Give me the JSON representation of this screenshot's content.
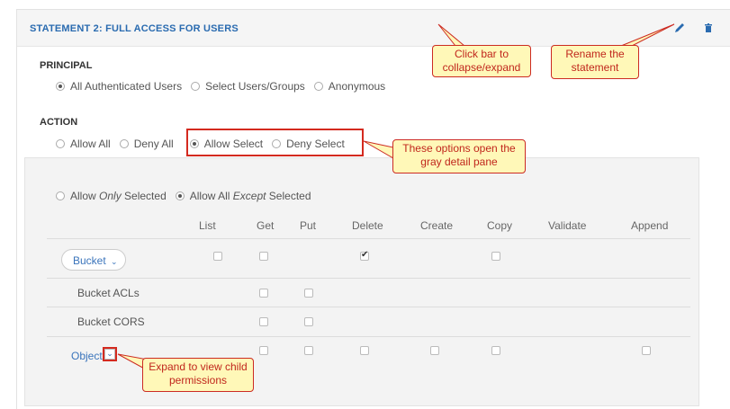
{
  "statement": {
    "title": "STATEMENT 2: FULL ACCESS FOR USERS",
    "edit_icon": "pencil-icon",
    "delete_icon": "trash-icon"
  },
  "principal": {
    "label": "PRINCIPAL",
    "options": [
      "All Authenticated Users",
      "Select Users/Groups",
      "Anonymous"
    ],
    "selected": "All Authenticated Users"
  },
  "action": {
    "label": "ACTION",
    "options": [
      "Allow All",
      "Deny All",
      "Allow Select",
      "Deny Select"
    ],
    "selected": "Allow Select"
  },
  "detail": {
    "mode_options": {
      "only_prefix": "Allow ",
      "only_em": "Only",
      "only_suffix": " Selected",
      "except_prefix": "Allow All ",
      "except_em": "Except",
      "except_suffix": " Selected"
    },
    "mode_selected": "except",
    "columns": [
      "List",
      "Get",
      "Put",
      "Delete",
      "Create",
      "Copy",
      "Validate",
      "Append"
    ],
    "rows": [
      {
        "label": "Bucket",
        "checks": [
          false,
          false,
          null,
          true,
          null,
          false,
          null,
          null
        ]
      },
      {
        "label": "Bucket ACLs",
        "checks": [
          null,
          false,
          false,
          null,
          null,
          null,
          null,
          null
        ]
      },
      {
        "label": "Bucket CORS",
        "checks": [
          null,
          false,
          false,
          null,
          null,
          null,
          null,
          null
        ]
      },
      {
        "label": "Object",
        "checks": [
          null,
          false,
          false,
          false,
          false,
          false,
          null,
          false
        ]
      }
    ]
  },
  "callouts": {
    "collapse": "Click bar to collapse/expand",
    "rename": "Rename the statement",
    "options": "These options open the gray detail pane",
    "expand": "Expand to view child permissions"
  },
  "colors": {
    "accent": "#2a6bb0",
    "callout_bg": "#fff8b8",
    "callout_border": "#cc2b22"
  }
}
